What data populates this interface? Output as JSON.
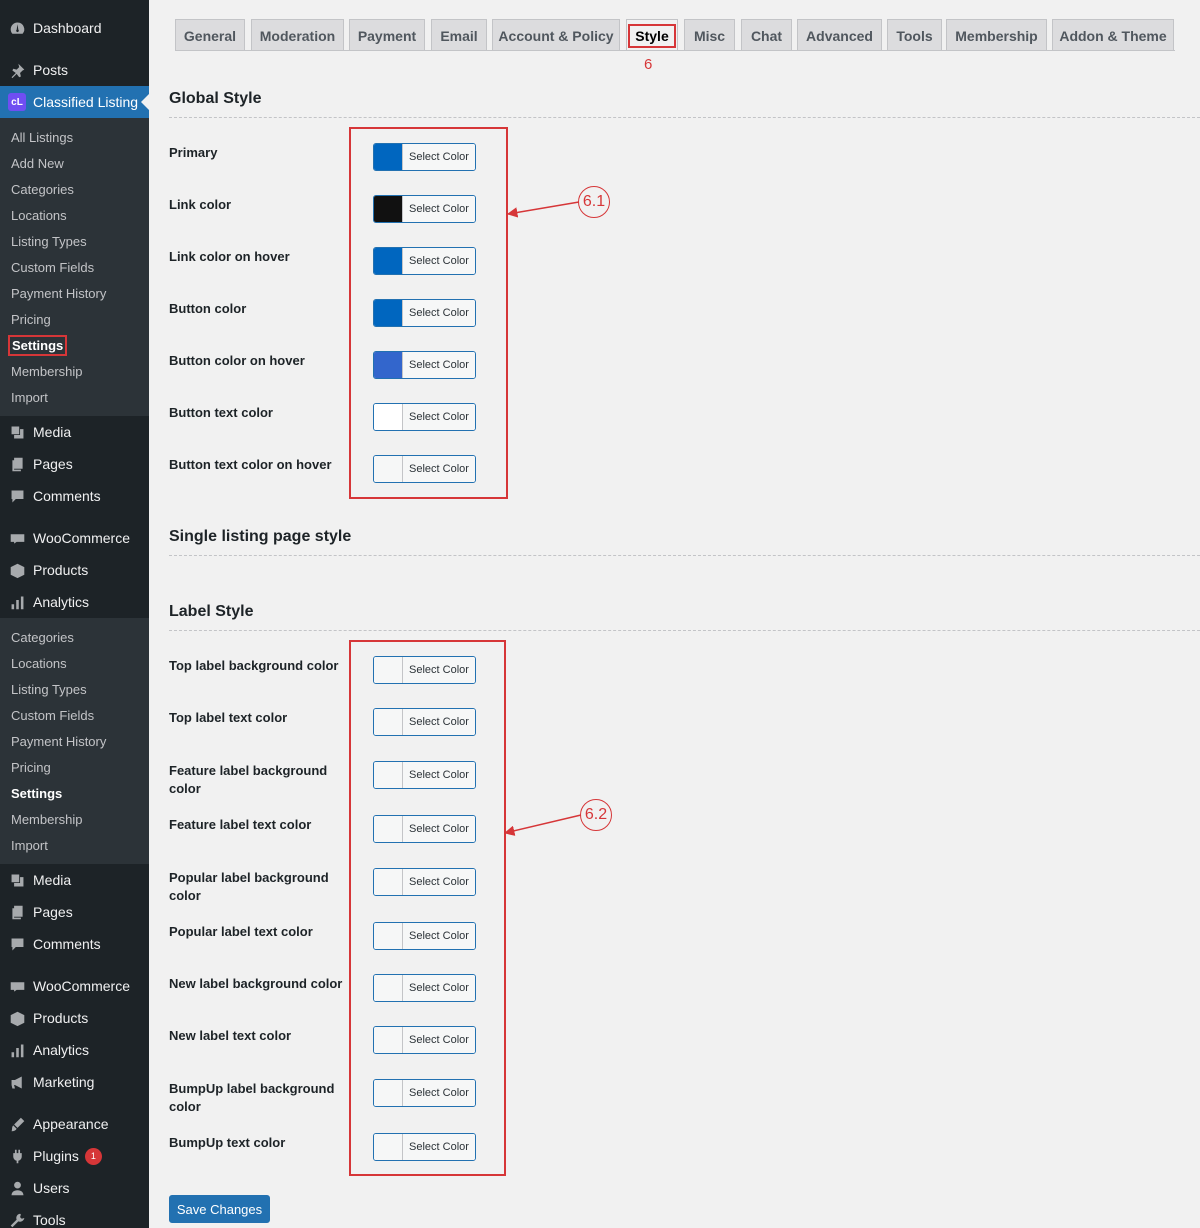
{
  "sidebar": {
    "top_items": [
      {
        "label": "Dashboard",
        "icon": "dashboard-icon"
      },
      {
        "label": "Posts",
        "icon": "pin-icon"
      },
      {
        "label": "Classified Listing",
        "icon": "classified-listing-logo",
        "logo_text": "cL"
      }
    ],
    "cl_submenu": [
      "All Listings",
      "Add New",
      "Categories",
      "Locations",
      "Listing Types",
      "Custom Fields",
      "Payment History",
      "Pricing",
      "Settings",
      "Membership",
      "Import"
    ],
    "mid_items": [
      {
        "label": "Media",
        "icon": "media-icon"
      },
      {
        "label": "Pages",
        "icon": "pages-icon"
      },
      {
        "label": "Comments",
        "icon": "comments-icon"
      }
    ],
    "woo_items": [
      {
        "label": "WooCommerce",
        "icon": "woo-icon"
      },
      {
        "label": "Products",
        "icon": "products-icon"
      },
      {
        "label": "Analytics",
        "icon": "analytics-icon"
      }
    ],
    "submenu2": [
      "Categories",
      "Locations",
      "Listing Types",
      "Custom Fields",
      "Payment History",
      "Pricing",
      "Settings",
      "Membership",
      "Import"
    ],
    "mid_items2": [
      {
        "label": "Media",
        "icon": "media-icon"
      },
      {
        "label": "Pages",
        "icon": "pages-icon"
      },
      {
        "label": "Comments",
        "icon": "comments-icon"
      }
    ],
    "woo_items2": [
      {
        "label": "WooCommerce",
        "icon": "woo-icon"
      },
      {
        "label": "Products",
        "icon": "products-icon"
      },
      {
        "label": "Analytics",
        "icon": "analytics-icon"
      },
      {
        "label": "Marketing",
        "icon": "marketing-icon"
      }
    ],
    "bottom_items": [
      {
        "label": "Appearance",
        "icon": "appearance-icon"
      },
      {
        "label": "Plugins",
        "icon": "plugins-icon",
        "badge": "1"
      },
      {
        "label": "Users",
        "icon": "users-icon"
      },
      {
        "label": "Tools",
        "icon": "tools-icon"
      }
    ]
  },
  "tabs": [
    "General",
    "Moderation",
    "Payment",
    "Email",
    "Account & Policy",
    "Style",
    "Misc",
    "Chat",
    "Advanced",
    "Tools",
    "Membership",
    "Addon & Theme"
  ],
  "active_tab": "Style",
  "annotations": {
    "tab": "6",
    "global": "6.1",
    "label": "6.2"
  },
  "sections": {
    "global": "Global Style",
    "single": "Single listing page style",
    "label": "Label Style"
  },
  "select_color_label": "Select Color",
  "global_rows": [
    {
      "label": "Primary",
      "color": "#0066bf"
    },
    {
      "label": "Link color",
      "color": "#111111"
    },
    {
      "label": "Link color on hover",
      "color": "#0066bf"
    },
    {
      "label": "Button color",
      "color": "#0066bf"
    },
    {
      "label": "Button color on hover",
      "color": "#3366cc"
    },
    {
      "label": "Button text color",
      "color": "#ffffff"
    },
    {
      "label": "Button text color on hover",
      "color": "#f6f7f7"
    }
  ],
  "label_rows": [
    {
      "label": "Top label background color",
      "color": "#f6f7f7"
    },
    {
      "label": "Top label text color",
      "color": "#f6f7f7"
    },
    {
      "label": "Feature label background color",
      "color": "#f6f7f7"
    },
    {
      "label": "Feature label text color",
      "color": "#f6f7f7"
    },
    {
      "label": "Popular label background color",
      "color": "#f6f7f7"
    },
    {
      "label": "Popular label text color",
      "color": "#f6f7f7"
    },
    {
      "label": "New label background color",
      "color": "#f6f7f7"
    },
    {
      "label": "New label text color",
      "color": "#f6f7f7"
    },
    {
      "label": "BumpUp label background color",
      "color": "#f6f7f7"
    },
    {
      "label": "BumpUp text color",
      "color": "#f6f7f7"
    }
  ],
  "save_label": "Save Changes"
}
